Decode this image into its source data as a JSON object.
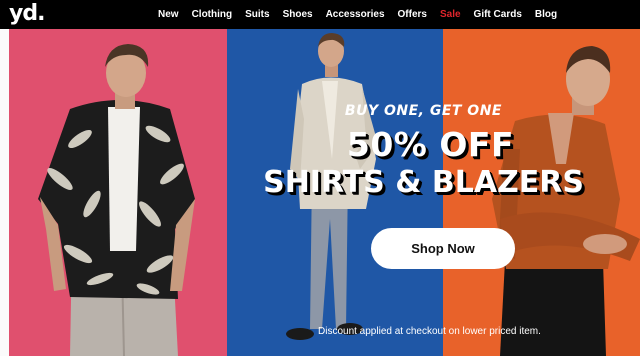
{
  "brand": {
    "logo_text": "yd."
  },
  "nav": {
    "items": [
      {
        "label": "New"
      },
      {
        "label": "Clothing"
      },
      {
        "label": "Suits"
      },
      {
        "label": "Shoes"
      },
      {
        "label": "Accessories"
      },
      {
        "label": "Offers"
      },
      {
        "label": "Sale",
        "color": "#e0252c"
      },
      {
        "label": "Gift Cards"
      },
      {
        "label": "Blog"
      }
    ]
  },
  "hero": {
    "panel_colors": {
      "left": "#e0506e",
      "middle": "#1f57a6",
      "right": "#e8622a"
    },
    "kicker": "BUY ONE, GET ONE",
    "headline_1": "50% OFF",
    "headline_2": "SHIRTS & BLAZERS",
    "cta_label": "Shop Now",
    "disclaimer": "Discount applied at checkout on lower priced item."
  }
}
